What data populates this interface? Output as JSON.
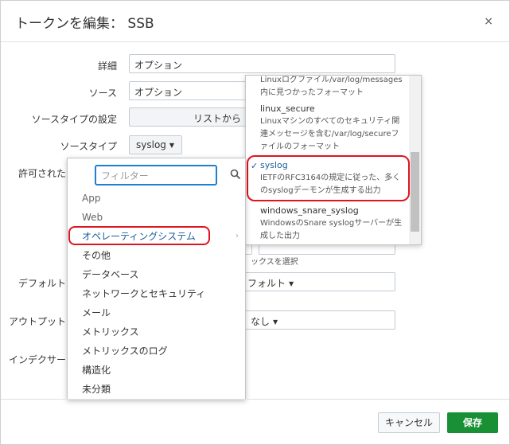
{
  "dialog": {
    "title": "トークンを編集： SSB",
    "close": "×"
  },
  "form": {
    "detail_label": "詳細",
    "detail_placeholder": "オプション",
    "source_label": "ソース",
    "source_placeholder": "オプション",
    "sourcetype_setting_label": "ソースタイプの設定",
    "sourcetype_setting_value": "リストから",
    "sourcetype_label": "ソースタイプ",
    "sourcetype_value": "syslog",
    "allowed_label": "許可された",
    "default_label": "デフォルト",
    "default_value": "フォルト",
    "output_label": "アウトプット",
    "output_value": "なし",
    "indexer_label": "インデクサー",
    "select_hint": "ックスを選択"
  },
  "category_menu": {
    "filter_placeholder": "フィルター",
    "items": [
      "App",
      "Web",
      "オペレーティングシステム",
      "その他",
      "データベース",
      "ネットワークとセキュリティ",
      "メール",
      "メトリックス",
      "メトリックスのログ",
      "構造化",
      "未分類"
    ]
  },
  "sourcetype_menu": {
    "items": [
      {
        "name": "",
        "desc": "Linuxログファイル/var/log/messages内に見つかったフォーマット"
      },
      {
        "name": "linux_secure",
        "desc": "Linuxマシンのすべてのセキュリティ関連メッセージを含む/var/log/secureファイルのフォーマット"
      },
      {
        "name": "syslog",
        "desc": "IETFのRFC3164の規定に従った、多くのsyslogデーモンが生成する出力"
      },
      {
        "name": "windows_snare_syslog",
        "desc": "WindowsのSnare syslogサーバーが生成した出力"
      }
    ],
    "check": "✓"
  },
  "footer": {
    "cancel": "キャンセル",
    "save": "保存"
  },
  "colors": {
    "save_green": "#1a9035",
    "highlight_red": "#e0141f",
    "link_blue": "#1a5b9a"
  }
}
